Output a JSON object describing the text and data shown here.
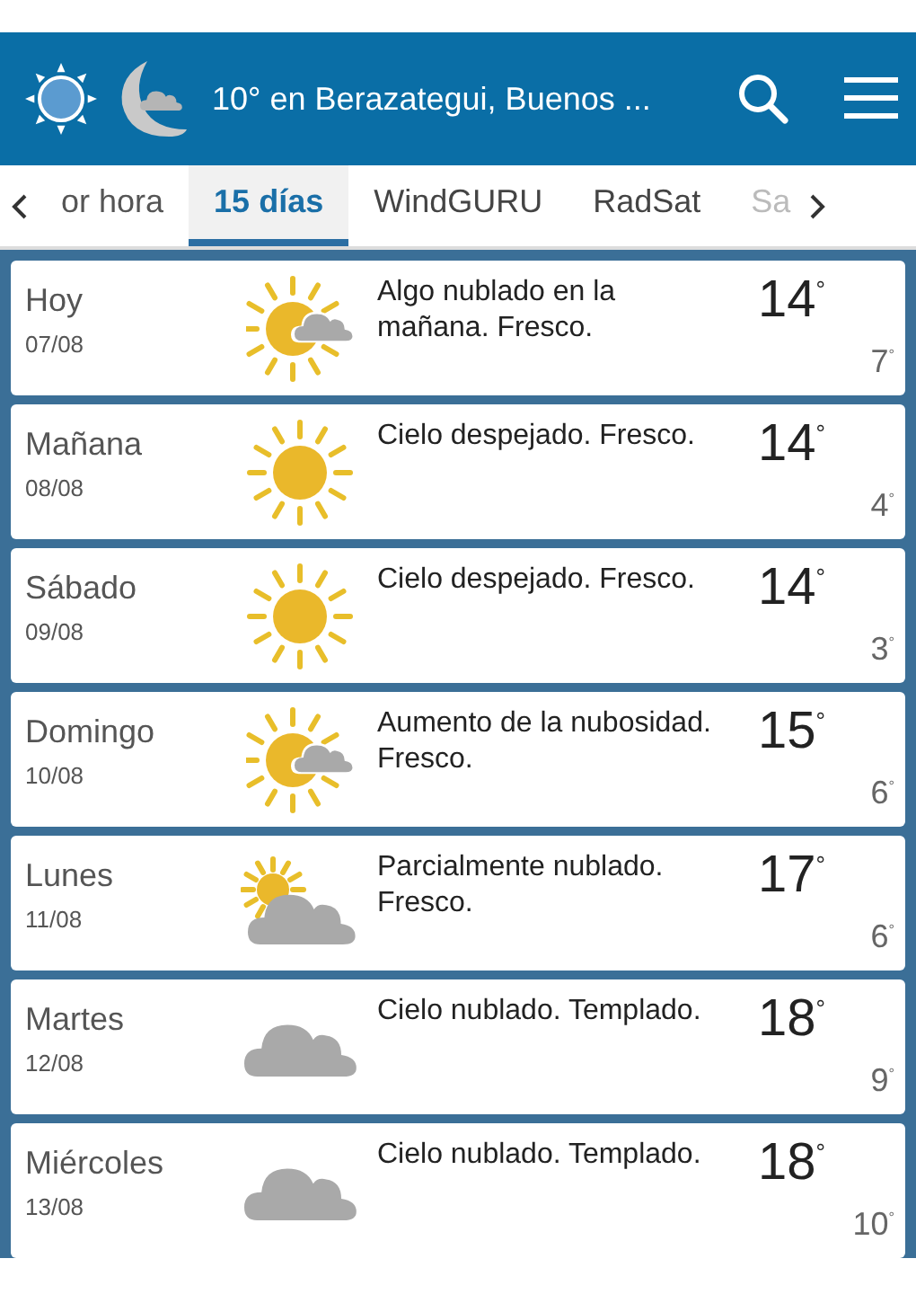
{
  "header": {
    "title": "10° en Berazategui, Buenos ..."
  },
  "tabs": [
    {
      "label": "or hora",
      "selected": false
    },
    {
      "label": "15 días",
      "selected": true
    },
    {
      "label": "WindGURU",
      "selected": false
    },
    {
      "label": "RadSat",
      "selected": false
    },
    {
      "label": "Sa",
      "selected": false
    }
  ],
  "days": [
    {
      "day": "Hoy",
      "date": "07/08",
      "kind": "sun_cloud",
      "description": "Algo nublado en la mañana. Fresco.",
      "high": "14$^{°}$",
      "low": "7$^{°}$"
    },
    {
      "day": "Mañana",
      "date": "08/08",
      "kind": "sun",
      "description": "Cielo despejado. Fresco.",
      "high": "14$^{°}$",
      "low": "4$^{°}$"
    },
    {
      "day": "Sábado",
      "date": "09/08",
      "kind": "sun",
      "description": "Cielo despejado. Fresco.",
      "high": "14$^{°}$",
      "low": "3$^{°}$"
    },
    {
      "day": "Domingo",
      "date": "10/08",
      "kind": "sun_cloud",
      "description": "Aumento de la nubosidad. Fresco.",
      "high": "15$^{°}$",
      "low": "6$^{°}$"
    },
    {
      "day": "Lunes",
      "date": "11/08",
      "kind": "partly",
      "description": "Parcialmente nublado. Fresco.",
      "high": "17$^{°}$",
      "low": "6$^{°}$"
    },
    {
      "day": "Martes",
      "date": "12/08",
      "kind": "cloud",
      "description": "Cielo nublado. Templado.",
      "high": "18$^{°}$",
      "low": "9$^{°}$"
    },
    {
      "day": "Miércoles",
      "date": "13/08",
      "kind": "cloud",
      "description": "Cielo nublado. Templado.",
      "high": "18$^{°}$",
      "low": "10$^{°}$"
    }
  ]
}
